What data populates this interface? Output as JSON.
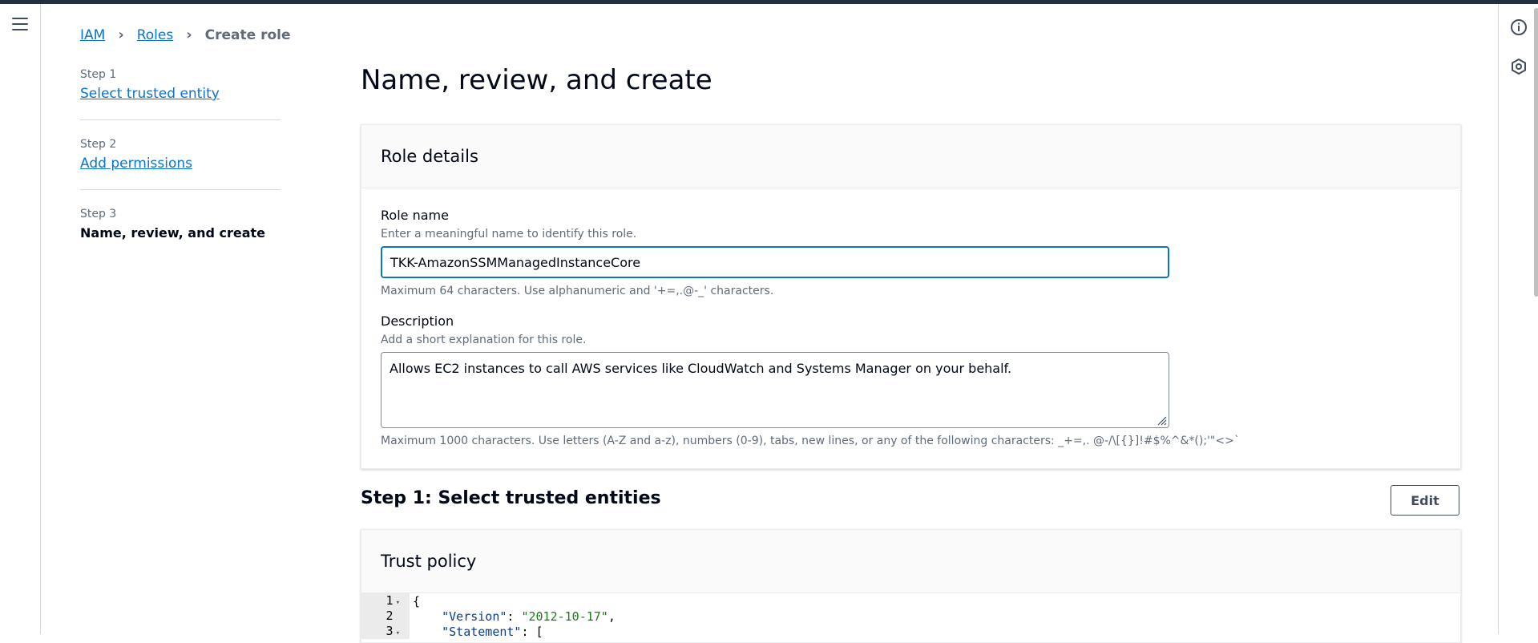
{
  "breadcrumb": {
    "items": [
      "IAM",
      "Roles"
    ],
    "current": "Create role"
  },
  "steps": [
    {
      "number": "Step 1",
      "label": "Select trusted entity"
    },
    {
      "number": "Step 2",
      "label": "Add permissions"
    },
    {
      "number": "Step 3",
      "label": "Name, review, and create"
    }
  ],
  "page": {
    "title": "Name, review, and create"
  },
  "role_details": {
    "title": "Role details",
    "role_name": {
      "label": "Role name",
      "description": "Enter a meaningful name to identify this role.",
      "value": "TKK-AmazonSSMManagedInstanceCore",
      "hint": "Maximum 64 characters. Use alphanumeric and '+=,.@-_' characters."
    },
    "description": {
      "label": "Description",
      "description": "Add a short explanation for this role.",
      "value": "Allows EC2 instances to call AWS services like CloudWatch and Systems Manager on your behalf.",
      "hint": "Maximum 1000 characters. Use letters (A-Z and a-z), numbers (0-9), tabs, new lines, or any of the following characters: _+=,. @-/\\[{}]!#$%^&*();'\"<>`"
    }
  },
  "step1_section": {
    "title": "Step 1: Select trusted entities",
    "edit_label": "Edit"
  },
  "trust_policy": {
    "title": "Trust policy",
    "lines": [
      {
        "num": "1",
        "fold": true,
        "open": "{"
      },
      {
        "num": "2",
        "fold": false,
        "key": "\"Version\"",
        "sep": ": ",
        "val": "\"2012-10-17\"",
        "tail": ","
      },
      {
        "num": "3",
        "fold": true,
        "key": "\"Statement\"",
        "sep": ": ",
        "val": "",
        "tail": "["
      }
    ]
  },
  "icons": {
    "menu": "hamburger-menu-icon",
    "info": "info-icon",
    "feedback": "hexagon-icon"
  },
  "colors": {
    "link": "#0972d3",
    "topbar": "#232f3e",
    "focus_border": "#0972d3"
  }
}
